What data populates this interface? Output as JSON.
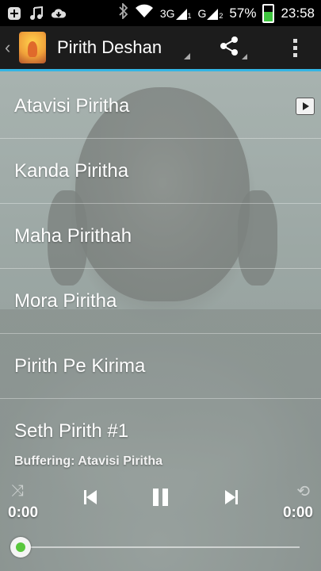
{
  "status_bar": {
    "icons": [
      "add-icon",
      "music-icon",
      "cloud-download-icon",
      "bluetooth-icon",
      "wifi-icon"
    ],
    "network_1": "3G",
    "network_1_sim": "1",
    "network_2": "G",
    "network_2_sim": "2",
    "battery": "57%",
    "battery_level": 0.57,
    "time": "23:58"
  },
  "action_bar": {
    "title": "Pirith Deshan",
    "back_glyph": "‹",
    "icons": [
      "app-icon",
      "share-icon",
      "overflow-menu-icon"
    ]
  },
  "list": {
    "items": [
      {
        "label": "Atavisi Piritha",
        "playing": true
      },
      {
        "label": "Kanda Piritha"
      },
      {
        "label": "Maha Pirithah"
      },
      {
        "label": "Mora Piritha"
      },
      {
        "label": "Pirith Pe Kirima"
      },
      {
        "label": "Seth Pirith #1"
      }
    ]
  },
  "player": {
    "status": "Buffering: Atavisi Piritha",
    "elapsed": "0:00",
    "duration": "0:00",
    "shuffle_glyph": "⤨",
    "repeat_glyph": "⟲",
    "progress": 0,
    "accent": "#59c73d"
  },
  "colors": {
    "action_bar": "#1c1c1c",
    "accent_line": "#33b5e5"
  }
}
